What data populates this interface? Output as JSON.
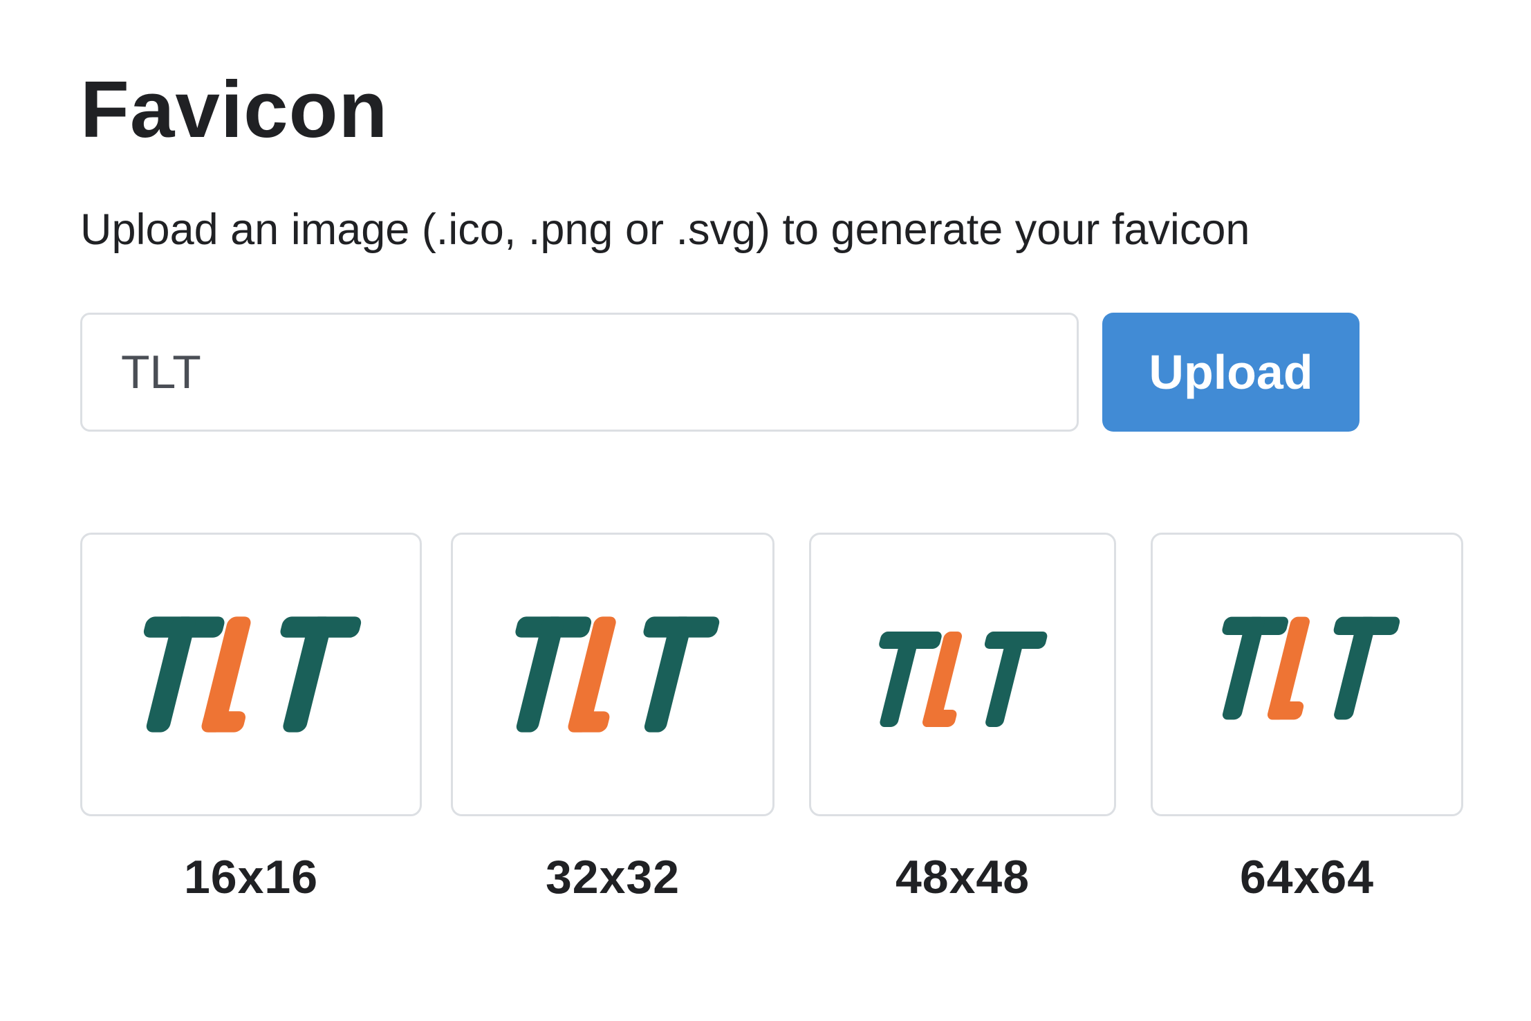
{
  "header": {
    "title": "Favicon",
    "subtitle": "Upload an image (.ico, .png or .svg) to generate your favicon"
  },
  "upload": {
    "input_value": "TLT",
    "button_label": "Upload"
  },
  "previews": [
    {
      "label": "16x16",
      "logo_text": "TLT"
    },
    {
      "label": "32x32",
      "logo_text": "TLT"
    },
    {
      "label": "48x48",
      "logo_text": "TLT"
    },
    {
      "label": "64x64",
      "logo_text": "TLT"
    }
  ],
  "colors": {
    "logo_primary": "#1a6059",
    "logo_accent": "#ee7434",
    "button": "#418bd5",
    "border": "#dcdfe3",
    "text": "#202124"
  }
}
